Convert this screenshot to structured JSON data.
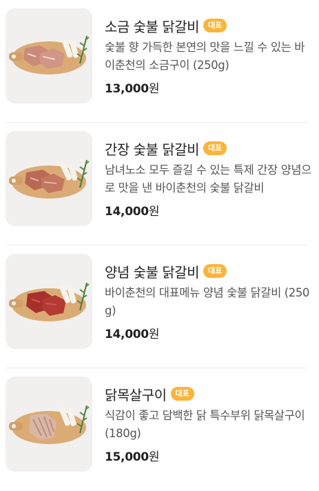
{
  "colors": {
    "badge": "#f9b43a",
    "title": "#222222",
    "description": "#555555",
    "divider": "#ececec"
  },
  "menu": {
    "items": [
      {
        "title": "소금 숯불 닭갈비",
        "badge": "대표",
        "description": "숯불 향 가득한 본연의 맛을 느낄 수 있는 바이춘천의 소금구이 (250g)",
        "price": "13,000",
        "unit": "원",
        "image_icon": "salt-chicken-galbi-photo",
        "meat_color": "#c98a7a"
      },
      {
        "title": "간장 숯불 닭갈비",
        "badge": "대표",
        "description": "남녀노소 모두 즐길 수 있는 특제 간장 양념으로 맛을 낸 바이춘천의 숯불 닭갈비",
        "price": "14,000",
        "unit": "원",
        "image_icon": "soy-chicken-galbi-photo",
        "meat_color": "#b86a55"
      },
      {
        "title": "양념 숯불 닭갈비",
        "badge": "대표",
        "description": "바이춘천의 대표메뉴 양념 숯불 닭갈비 (250g)",
        "price": "14,000",
        "unit": "원",
        "image_icon": "spicy-chicken-galbi-photo",
        "meat_color": "#a8302c"
      },
      {
        "title": "닭목살구이",
        "badge": "대표",
        "description": "식감이 좋고 담백한 닭 특수부위 닭목살구이 (180g)",
        "price": "15,000",
        "unit": "원",
        "image_icon": "chicken-neck-photo",
        "meat_color": "#d9b7a6"
      }
    ]
  }
}
